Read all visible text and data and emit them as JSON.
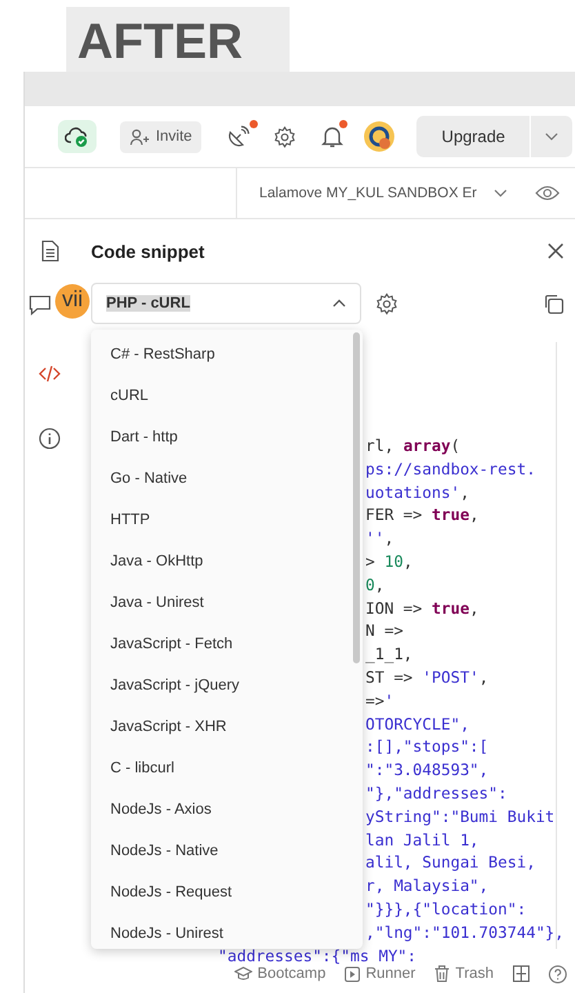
{
  "overlay_label": "AFTER",
  "toolbar": {
    "invite": "Invite",
    "upgrade": "Upgrade",
    "satellite_has_notification": true,
    "bell_has_notification": true
  },
  "environment": {
    "name": "Lalamove MY_KUL SANDBOX Er"
  },
  "panel": {
    "title": "Code snippet",
    "language": "PHP - cURL",
    "annotation_badge": "vii"
  },
  "language_options": [
    "C# - RestSharp",
    "cURL",
    "Dart - http",
    "Go - Native",
    "HTTP",
    "Java - OkHttp",
    "Java - Unirest",
    "JavaScript - Fetch",
    "JavaScript - jQuery",
    "JavaScript - XHR",
    "C - libcurl",
    "NodeJs - Axios",
    "NodeJs - Native",
    "NodeJs - Request",
    "NodeJs - Unirest"
  ],
  "code_lines": [
    [
      {
        "kind": "plain",
        "text": "rl, "
      },
      {
        "kind": "keyword",
        "text": "array"
      },
      {
        "kind": "plain",
        "text": "("
      }
    ],
    [
      {
        "kind": "string",
        "text": "ps://sandbox-rest."
      }
    ],
    [
      {
        "kind": "string",
        "text": "uotations'"
      },
      {
        "kind": "plain",
        "text": ","
      }
    ],
    [
      {
        "kind": "plain",
        "text": "FER => "
      },
      {
        "kind": "keyword",
        "text": "true"
      },
      {
        "kind": "plain",
        "text": ","
      }
    ],
    [
      {
        "kind": "string",
        "text": "''"
      },
      {
        "kind": "plain",
        "text": ","
      }
    ],
    [
      {
        "kind": "plain",
        "text": "> "
      },
      {
        "kind": "number",
        "text": "10"
      },
      {
        "kind": "plain",
        "text": ","
      }
    ],
    [
      {
        "kind": "number",
        "text": "0"
      },
      {
        "kind": "plain",
        "text": ","
      }
    ],
    [
      {
        "kind": "plain",
        "text": "ION => "
      },
      {
        "kind": "keyword",
        "text": "true"
      },
      {
        "kind": "plain",
        "text": ","
      }
    ],
    [
      {
        "kind": "plain",
        "text": "N =>"
      }
    ],
    [
      {
        "kind": "plain",
        "text": "_1_1,"
      }
    ],
    [
      {
        "kind": "plain",
        "text": "ST => "
      },
      {
        "kind": "string",
        "text": "'POST'"
      },
      {
        "kind": "plain",
        "text": ","
      }
    ],
    [
      {
        "kind": "plain",
        "text": "=>"
      },
      {
        "kind": "string",
        "text": "'"
      }
    ],
    [
      {
        "kind": "string",
        "text": "OTORCYCLE\","
      }
    ],
    [
      {
        "kind": "string",
        "text": ":[],\"stops\":["
      }
    ],
    [
      {
        "kind": "string",
        "text": "\":\"3.048593\","
      }
    ],
    [
      {
        "kind": "string",
        "text": "\"},\"addresses\":"
      }
    ],
    [
      {
        "kind": "string",
        "text": "yString\":\"Bumi Bukit"
      }
    ],
    [
      {
        "kind": "string",
        "text": "lan Jalil 1,"
      }
    ],
    [
      {
        "kind": "string",
        "text": "alil, Sungai Besi,"
      }
    ],
    [
      {
        "kind": "string",
        "text": "r, Malaysia\","
      }
    ],
    [
      {
        "kind": "string",
        "text": "\"}}},{\"location\":"
      }
    ],
    [
      {
        "kind": "string",
        "text": ",\"lng\":\"101.703744\"},"
      }
    ]
  ],
  "code_last_line": [
    {
      "kind": "string",
      "text": "\"addresses\":{\"ms MY\":"
    }
  ],
  "status_bar": {
    "items": [
      {
        "kind": "bootcamp",
        "label": "Bootcamp"
      },
      {
        "kind": "runner",
        "label": "Runner"
      },
      {
        "kind": "trash",
        "label": "Trash"
      }
    ]
  }
}
